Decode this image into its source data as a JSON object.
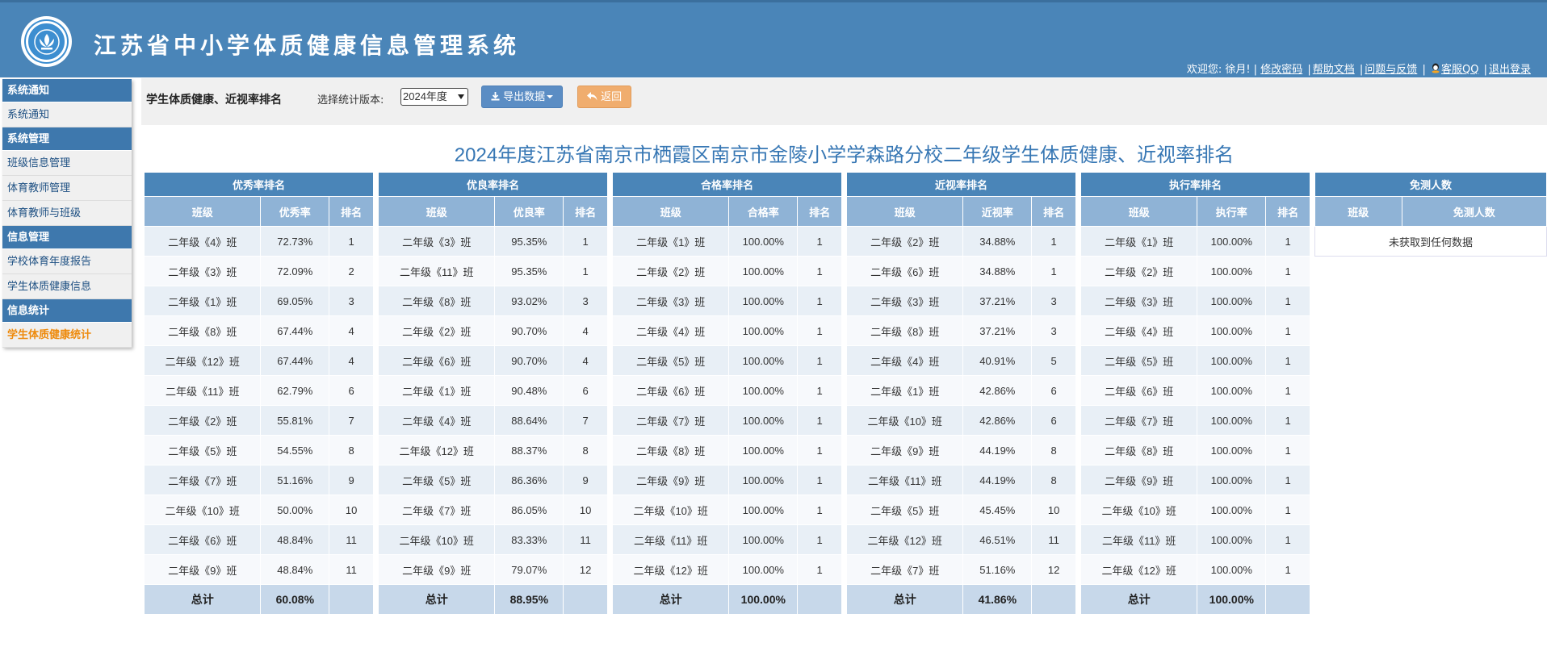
{
  "header": {
    "title": "江苏省中小学体质健康信息管理系统",
    "welcome": "欢迎您: 徐月! |",
    "links": [
      "修改密码",
      "帮助文档",
      "问题与反馈",
      "客服QQ",
      "退出登录"
    ]
  },
  "sidebar": [
    {
      "group": "系统通知",
      "items": [
        {
          "label": "系统通知"
        }
      ]
    },
    {
      "group": "系统管理",
      "items": [
        {
          "label": "班级信息管理"
        },
        {
          "label": "体育教师管理"
        },
        {
          "label": "体育教师与班级"
        }
      ]
    },
    {
      "group": "信息管理",
      "items": [
        {
          "label": "学校体育年度报告"
        },
        {
          "label": "学生体质健康信息"
        }
      ]
    },
    {
      "group": "信息统计",
      "items": [
        {
          "label": "学生体质健康统计",
          "active": true
        }
      ]
    }
  ],
  "toolbar": {
    "page_title": "学生体质健康、近视率排名",
    "version_label": "选择统计版本:",
    "version_value": "2024年度",
    "export_label": "导出数据",
    "back_label": "返回"
  },
  "main_title": "2024年度江苏省南京市栖霞区南京市金陵小学学森路分校二年级学生体质健康、近视率排名",
  "tables": [
    {
      "title": "优秀率排名",
      "cols": [
        "班级",
        "优秀率",
        "排名"
      ],
      "rows": [
        [
          "二年级《4》班",
          "72.73%",
          "1"
        ],
        [
          "二年级《3》班",
          "72.09%",
          "2"
        ],
        [
          "二年级《1》班",
          "69.05%",
          "3"
        ],
        [
          "二年级《8》班",
          "67.44%",
          "4"
        ],
        [
          "二年级《12》班",
          "67.44%",
          "4"
        ],
        [
          "二年级《11》班",
          "62.79%",
          "6"
        ],
        [
          "二年级《2》班",
          "55.81%",
          "7"
        ],
        [
          "二年级《5》班",
          "54.55%",
          "8"
        ],
        [
          "二年级《7》班",
          "51.16%",
          "9"
        ],
        [
          "二年级《10》班",
          "50.00%",
          "10"
        ],
        [
          "二年级《6》班",
          "48.84%",
          "11"
        ],
        [
          "二年级《9》班",
          "48.84%",
          "11"
        ]
      ],
      "total": [
        "总计",
        "60.08%",
        ""
      ]
    },
    {
      "title": "优良率排名",
      "cols": [
        "班级",
        "优良率",
        "排名"
      ],
      "rows": [
        [
          "二年级《3》班",
          "95.35%",
          "1"
        ],
        [
          "二年级《11》班",
          "95.35%",
          "1"
        ],
        [
          "二年级《8》班",
          "93.02%",
          "3"
        ],
        [
          "二年级《2》班",
          "90.70%",
          "4"
        ],
        [
          "二年级《6》班",
          "90.70%",
          "4"
        ],
        [
          "二年级《1》班",
          "90.48%",
          "6"
        ],
        [
          "二年级《4》班",
          "88.64%",
          "7"
        ],
        [
          "二年级《12》班",
          "88.37%",
          "8"
        ],
        [
          "二年级《5》班",
          "86.36%",
          "9"
        ],
        [
          "二年级《7》班",
          "86.05%",
          "10"
        ],
        [
          "二年级《10》班",
          "83.33%",
          "11"
        ],
        [
          "二年级《9》班",
          "79.07%",
          "12"
        ]
      ],
      "total": [
        "总计",
        "88.95%",
        ""
      ]
    },
    {
      "title": "合格率排名",
      "cols": [
        "班级",
        "合格率",
        "排名"
      ],
      "rows": [
        [
          "二年级《1》班",
          "100.00%",
          "1"
        ],
        [
          "二年级《2》班",
          "100.00%",
          "1"
        ],
        [
          "二年级《3》班",
          "100.00%",
          "1"
        ],
        [
          "二年级《4》班",
          "100.00%",
          "1"
        ],
        [
          "二年级《5》班",
          "100.00%",
          "1"
        ],
        [
          "二年级《6》班",
          "100.00%",
          "1"
        ],
        [
          "二年级《7》班",
          "100.00%",
          "1"
        ],
        [
          "二年级《8》班",
          "100.00%",
          "1"
        ],
        [
          "二年级《9》班",
          "100.00%",
          "1"
        ],
        [
          "二年级《10》班",
          "100.00%",
          "1"
        ],
        [
          "二年级《11》班",
          "100.00%",
          "1"
        ],
        [
          "二年级《12》班",
          "100.00%",
          "1"
        ]
      ],
      "total": [
        "总计",
        "100.00%",
        ""
      ]
    },
    {
      "title": "近视率排名",
      "cols": [
        "班级",
        "近视率",
        "排名"
      ],
      "rows": [
        [
          "二年级《2》班",
          "34.88%",
          "1"
        ],
        [
          "二年级《6》班",
          "34.88%",
          "1"
        ],
        [
          "二年级《3》班",
          "37.21%",
          "3"
        ],
        [
          "二年级《8》班",
          "37.21%",
          "3"
        ],
        [
          "二年级《4》班",
          "40.91%",
          "5"
        ],
        [
          "二年级《1》班",
          "42.86%",
          "6"
        ],
        [
          "二年级《10》班",
          "42.86%",
          "6"
        ],
        [
          "二年级《9》班",
          "44.19%",
          "8"
        ],
        [
          "二年级《11》班",
          "44.19%",
          "8"
        ],
        [
          "二年级《5》班",
          "45.45%",
          "10"
        ],
        [
          "二年级《12》班",
          "46.51%",
          "11"
        ],
        [
          "二年级《7》班",
          "51.16%",
          "12"
        ]
      ],
      "total": [
        "总计",
        "41.86%",
        ""
      ]
    },
    {
      "title": "执行率排名",
      "cols": [
        "班级",
        "执行率",
        "排名"
      ],
      "rows": [
        [
          "二年级《1》班",
          "100.00%",
          "1"
        ],
        [
          "二年级《2》班",
          "100.00%",
          "1"
        ],
        [
          "二年级《3》班",
          "100.00%",
          "1"
        ],
        [
          "二年级《4》班",
          "100.00%",
          "1"
        ],
        [
          "二年级《5》班",
          "100.00%",
          "1"
        ],
        [
          "二年级《6》班",
          "100.00%",
          "1"
        ],
        [
          "二年级《7》班",
          "100.00%",
          "1"
        ],
        [
          "二年级《8》班",
          "100.00%",
          "1"
        ],
        [
          "二年级《9》班",
          "100.00%",
          "1"
        ],
        [
          "二年级《10》班",
          "100.00%",
          "1"
        ],
        [
          "二年级《11》班",
          "100.00%",
          "1"
        ],
        [
          "二年级《12》班",
          "100.00%",
          "1"
        ]
      ],
      "total": [
        "总计",
        "100.00%",
        ""
      ]
    }
  ],
  "exempt_table": {
    "title": "免测人数",
    "cols": [
      "班级",
      "免测人数"
    ],
    "empty_text": "未获取到任何数据"
  }
}
